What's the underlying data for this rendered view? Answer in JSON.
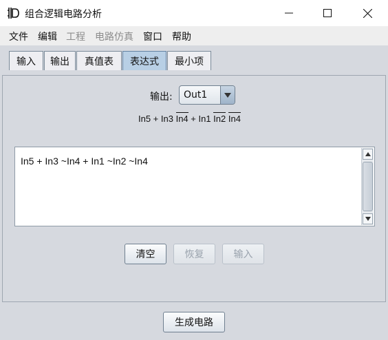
{
  "window": {
    "title": "组合逻辑电路分析"
  },
  "menu": [
    "文件",
    "编辑",
    "工程",
    "电路仿真",
    "窗口",
    "帮助"
  ],
  "menu_disabled": [
    false,
    false,
    true,
    true,
    false,
    false
  ],
  "tabs": [
    "输入",
    "输出",
    "真值表",
    "表达式",
    "最小项"
  ],
  "active_tab": "表达式",
  "output": {
    "label": "输出:",
    "selected": "Out1"
  },
  "formula": {
    "t1": "In5 + In3 ",
    "t2": "In4",
    "t3": " + In1 ",
    "t4": "In2",
    "t5": " ",
    "t6": "In4"
  },
  "expression_text": "In5 + In3 ~In4 + In1 ~In2 ~In4",
  "buttons": {
    "clear": "清空",
    "restore": "恢复",
    "input": "输入",
    "generate": "生成电路"
  },
  "colors": {
    "panel_bg": "#d6d9df",
    "active_tab": "#b8cfe5",
    "menubar": "#eeeeee"
  }
}
